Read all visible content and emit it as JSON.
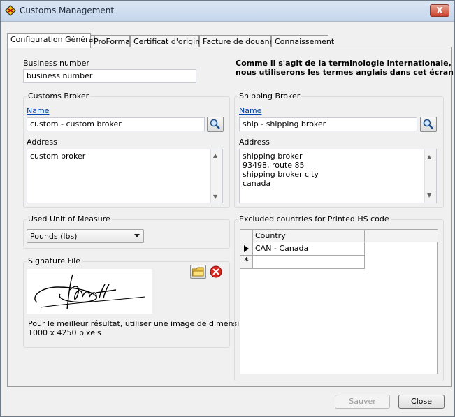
{
  "window": {
    "title": "Customs Management",
    "close_glyph": "X"
  },
  "tabs": [
    {
      "label": "Configuration Général"
    },
    {
      "label": "ProForma"
    },
    {
      "label": "Certificat d'origine"
    },
    {
      "label": "Facture de douane"
    },
    {
      "label": "Connaissement"
    }
  ],
  "business": {
    "label": "Business number",
    "value": "business number"
  },
  "note": {
    "line1": "Comme il s'agit de la terminologie internationale,",
    "line2": "nous utiliserons les termes anglais dans cet écran"
  },
  "customs_broker": {
    "title": "Customs Broker",
    "name_label": "Name",
    "name_value": "custom - custom broker",
    "address_label": "Address",
    "address_lines": [
      "custom broker"
    ]
  },
  "shipping_broker": {
    "title": "Shipping Broker",
    "name_label": "Name",
    "name_value": "ship - shipping broker",
    "address_label": "Address",
    "address_lines": [
      "shipping broker",
      "93498, route 85",
      "shipping broker city",
      "canada"
    ]
  },
  "unit": {
    "title": "Used Unit of Measure",
    "selected": "Pounds (lbs)"
  },
  "signature": {
    "title": "Signature File",
    "hint_line1": "Pour le meilleur résultat, utiliser une image de dimension",
    "hint_line2": "1000 x 4250 pixels"
  },
  "excluded": {
    "title": "Excluded countries for Printed HS code",
    "column": "Country",
    "rows": [
      {
        "value": "CAN - Canada"
      }
    ],
    "new_row_marker": "*"
  },
  "buttons": {
    "save": "Sauver",
    "close": "Close"
  },
  "colors": {
    "link": "#0645ad",
    "disabled_text": "#9a9a9a"
  },
  "icons": [
    "app-icon",
    "close-icon",
    "search-icon",
    "folder-icon",
    "delete-icon",
    "dropdown-arrow-icon",
    "row-pointer-icon"
  ]
}
